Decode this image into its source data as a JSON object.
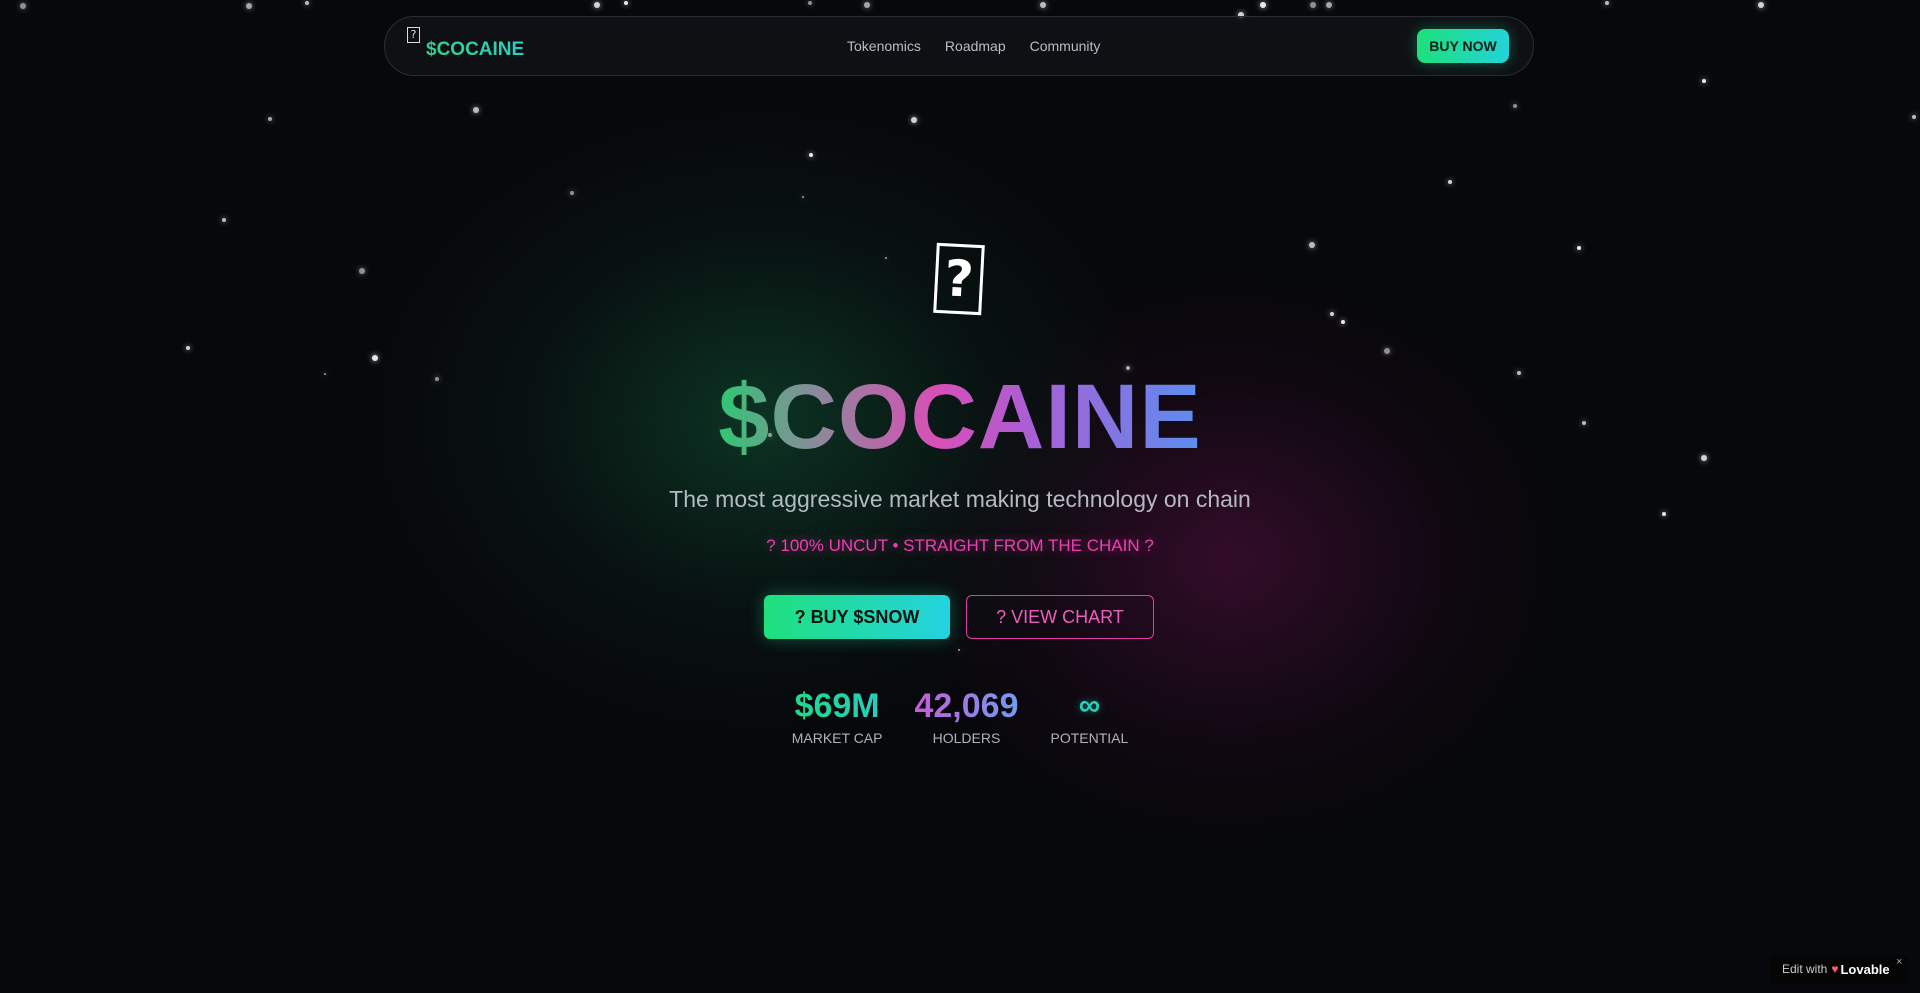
{
  "nav": {
    "brand_icon": "?",
    "brand_name": "$COCAINE",
    "links": [
      "Tokenomics",
      "Roadmap",
      "Community"
    ],
    "buy_label": "BUY NOW"
  },
  "hero": {
    "icon": "?",
    "title": "$COCAINE",
    "subtitle": "The most aggressive market making technology on chain",
    "tagline": "? 100% UNCUT • STRAIGHT FROM THE CHAIN ?",
    "buy_button": "? BUY $SNOW",
    "chart_button": "? VIEW CHART"
  },
  "stats": [
    {
      "value": "$69M",
      "label": "MARKET CAP"
    },
    {
      "value": "42,069",
      "label": "HOLDERS"
    },
    {
      "value": "∞",
      "label": "POTENTIAL"
    }
  ],
  "badge": {
    "prefix": "Edit with",
    "brand": "Lovable",
    "close": "×"
  },
  "colors": {
    "green": "#1fe07c",
    "cyan": "#22d3e0",
    "pink": "#ec3fb0",
    "background": "#07080b"
  }
}
